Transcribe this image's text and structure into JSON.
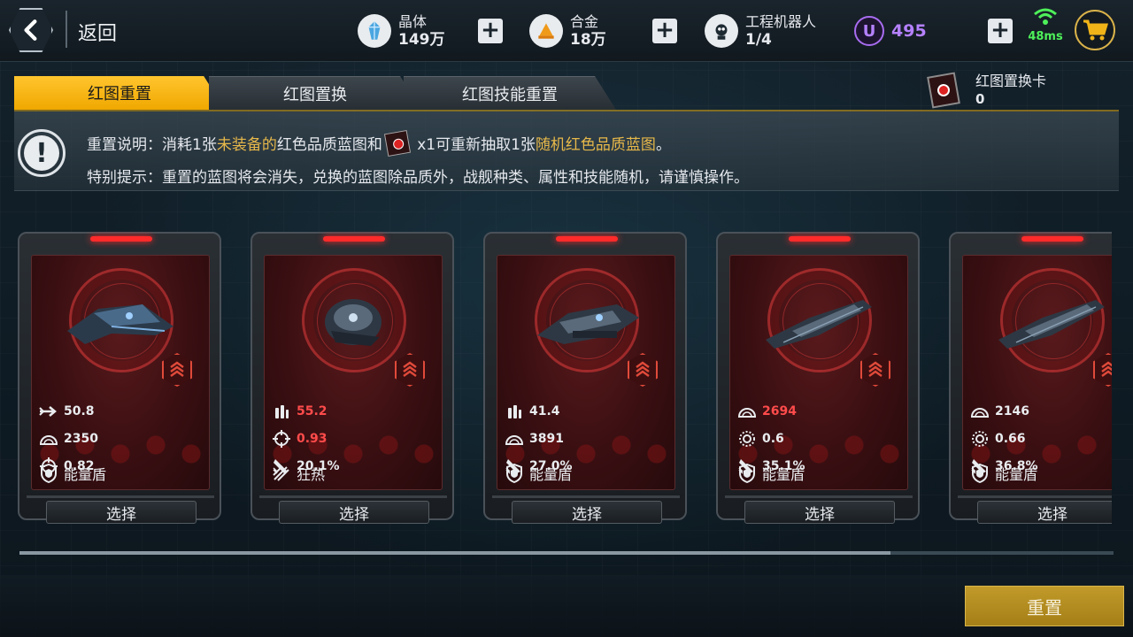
{
  "header": {
    "back_label": "返回",
    "resources": [
      {
        "name": "晶体",
        "value": "149万",
        "icon": "crystal-icon"
      },
      {
        "name": "合金",
        "value": "18万",
        "icon": "alloy-icon"
      },
      {
        "name": "工程机器人",
        "value": "1/4",
        "icon": "robot-icon"
      }
    ],
    "premium": {
      "symbol": "U",
      "value": "495"
    },
    "ping": "48ms",
    "colors": {
      "accent": "#f0b418",
      "premium": "#b581ff",
      "ping": "#4ef05a"
    }
  },
  "tabs": [
    {
      "label": "红图重置",
      "active": true
    },
    {
      "label": "红图置换",
      "active": false
    },
    {
      "label": "红图技能重置",
      "active": false
    }
  ],
  "swap_card": {
    "name": "红图置换卡",
    "count": "0"
  },
  "info": {
    "line1_prefix": "重置说明：消耗1张",
    "line1_hl1": "未装备的",
    "line1_mid": "红色品质蓝图和",
    "line1_qty": " x1可重新抽取1张",
    "line1_hl2": "随机红色品质蓝图",
    "line1_end": "。",
    "line2": "特别提示：重置的蓝图将会消失，兑换的蓝图除品质外，战舰种类、属性和技能随机，请谨慎操作。"
  },
  "cards": [
    {
      "stats": [
        {
          "icon": "speed-arrow-icon",
          "value": "50.8",
          "red": false
        },
        {
          "icon": "armor-icon",
          "value": "2350",
          "red": false
        },
        {
          "icon": "crosshair-icon",
          "value": "0.82",
          "red": false
        }
      ],
      "skill": {
        "icon": "shield-icon",
        "label": "能量盾"
      },
      "select_label": "选择"
    },
    {
      "stats": [
        {
          "icon": "ammo-icon",
          "value": "55.2",
          "red": true
        },
        {
          "icon": "crosshair-icon",
          "value": "0.93",
          "red": true
        },
        {
          "icon": "missile-icon",
          "value": "20.1%",
          "red": false
        }
      ],
      "skill": {
        "icon": "frenzy-icon",
        "label": "狂热"
      },
      "select_label": "选择"
    },
    {
      "stats": [
        {
          "icon": "ammo-icon",
          "value": "41.4",
          "red": false
        },
        {
          "icon": "armor-icon",
          "value": "3891",
          "red": false
        },
        {
          "icon": "missile-icon",
          "value": "27.0%",
          "red": false
        }
      ],
      "skill": {
        "icon": "shield-icon",
        "label": "能量盾"
      },
      "select_label": "选择"
    },
    {
      "stats": [
        {
          "icon": "armor-icon",
          "value": "2694",
          "red": true
        },
        {
          "icon": "gear-ring-icon",
          "value": "0.6",
          "red": false
        },
        {
          "icon": "missile-icon",
          "value": "35.1%",
          "red": false
        }
      ],
      "skill": {
        "icon": "shield-icon",
        "label": "能量盾"
      },
      "select_label": "选择"
    },
    {
      "stats": [
        {
          "icon": "armor-icon",
          "value": "2146",
          "red": false
        },
        {
          "icon": "gear-ring-icon",
          "value": "0.66",
          "red": false
        },
        {
          "icon": "missile-icon",
          "value": "36.8%",
          "red": false
        }
      ],
      "skill": {
        "icon": "shield-icon",
        "label": "能量盾"
      },
      "select_label": "选择"
    }
  ],
  "actions": {
    "reset_label": "重置"
  }
}
